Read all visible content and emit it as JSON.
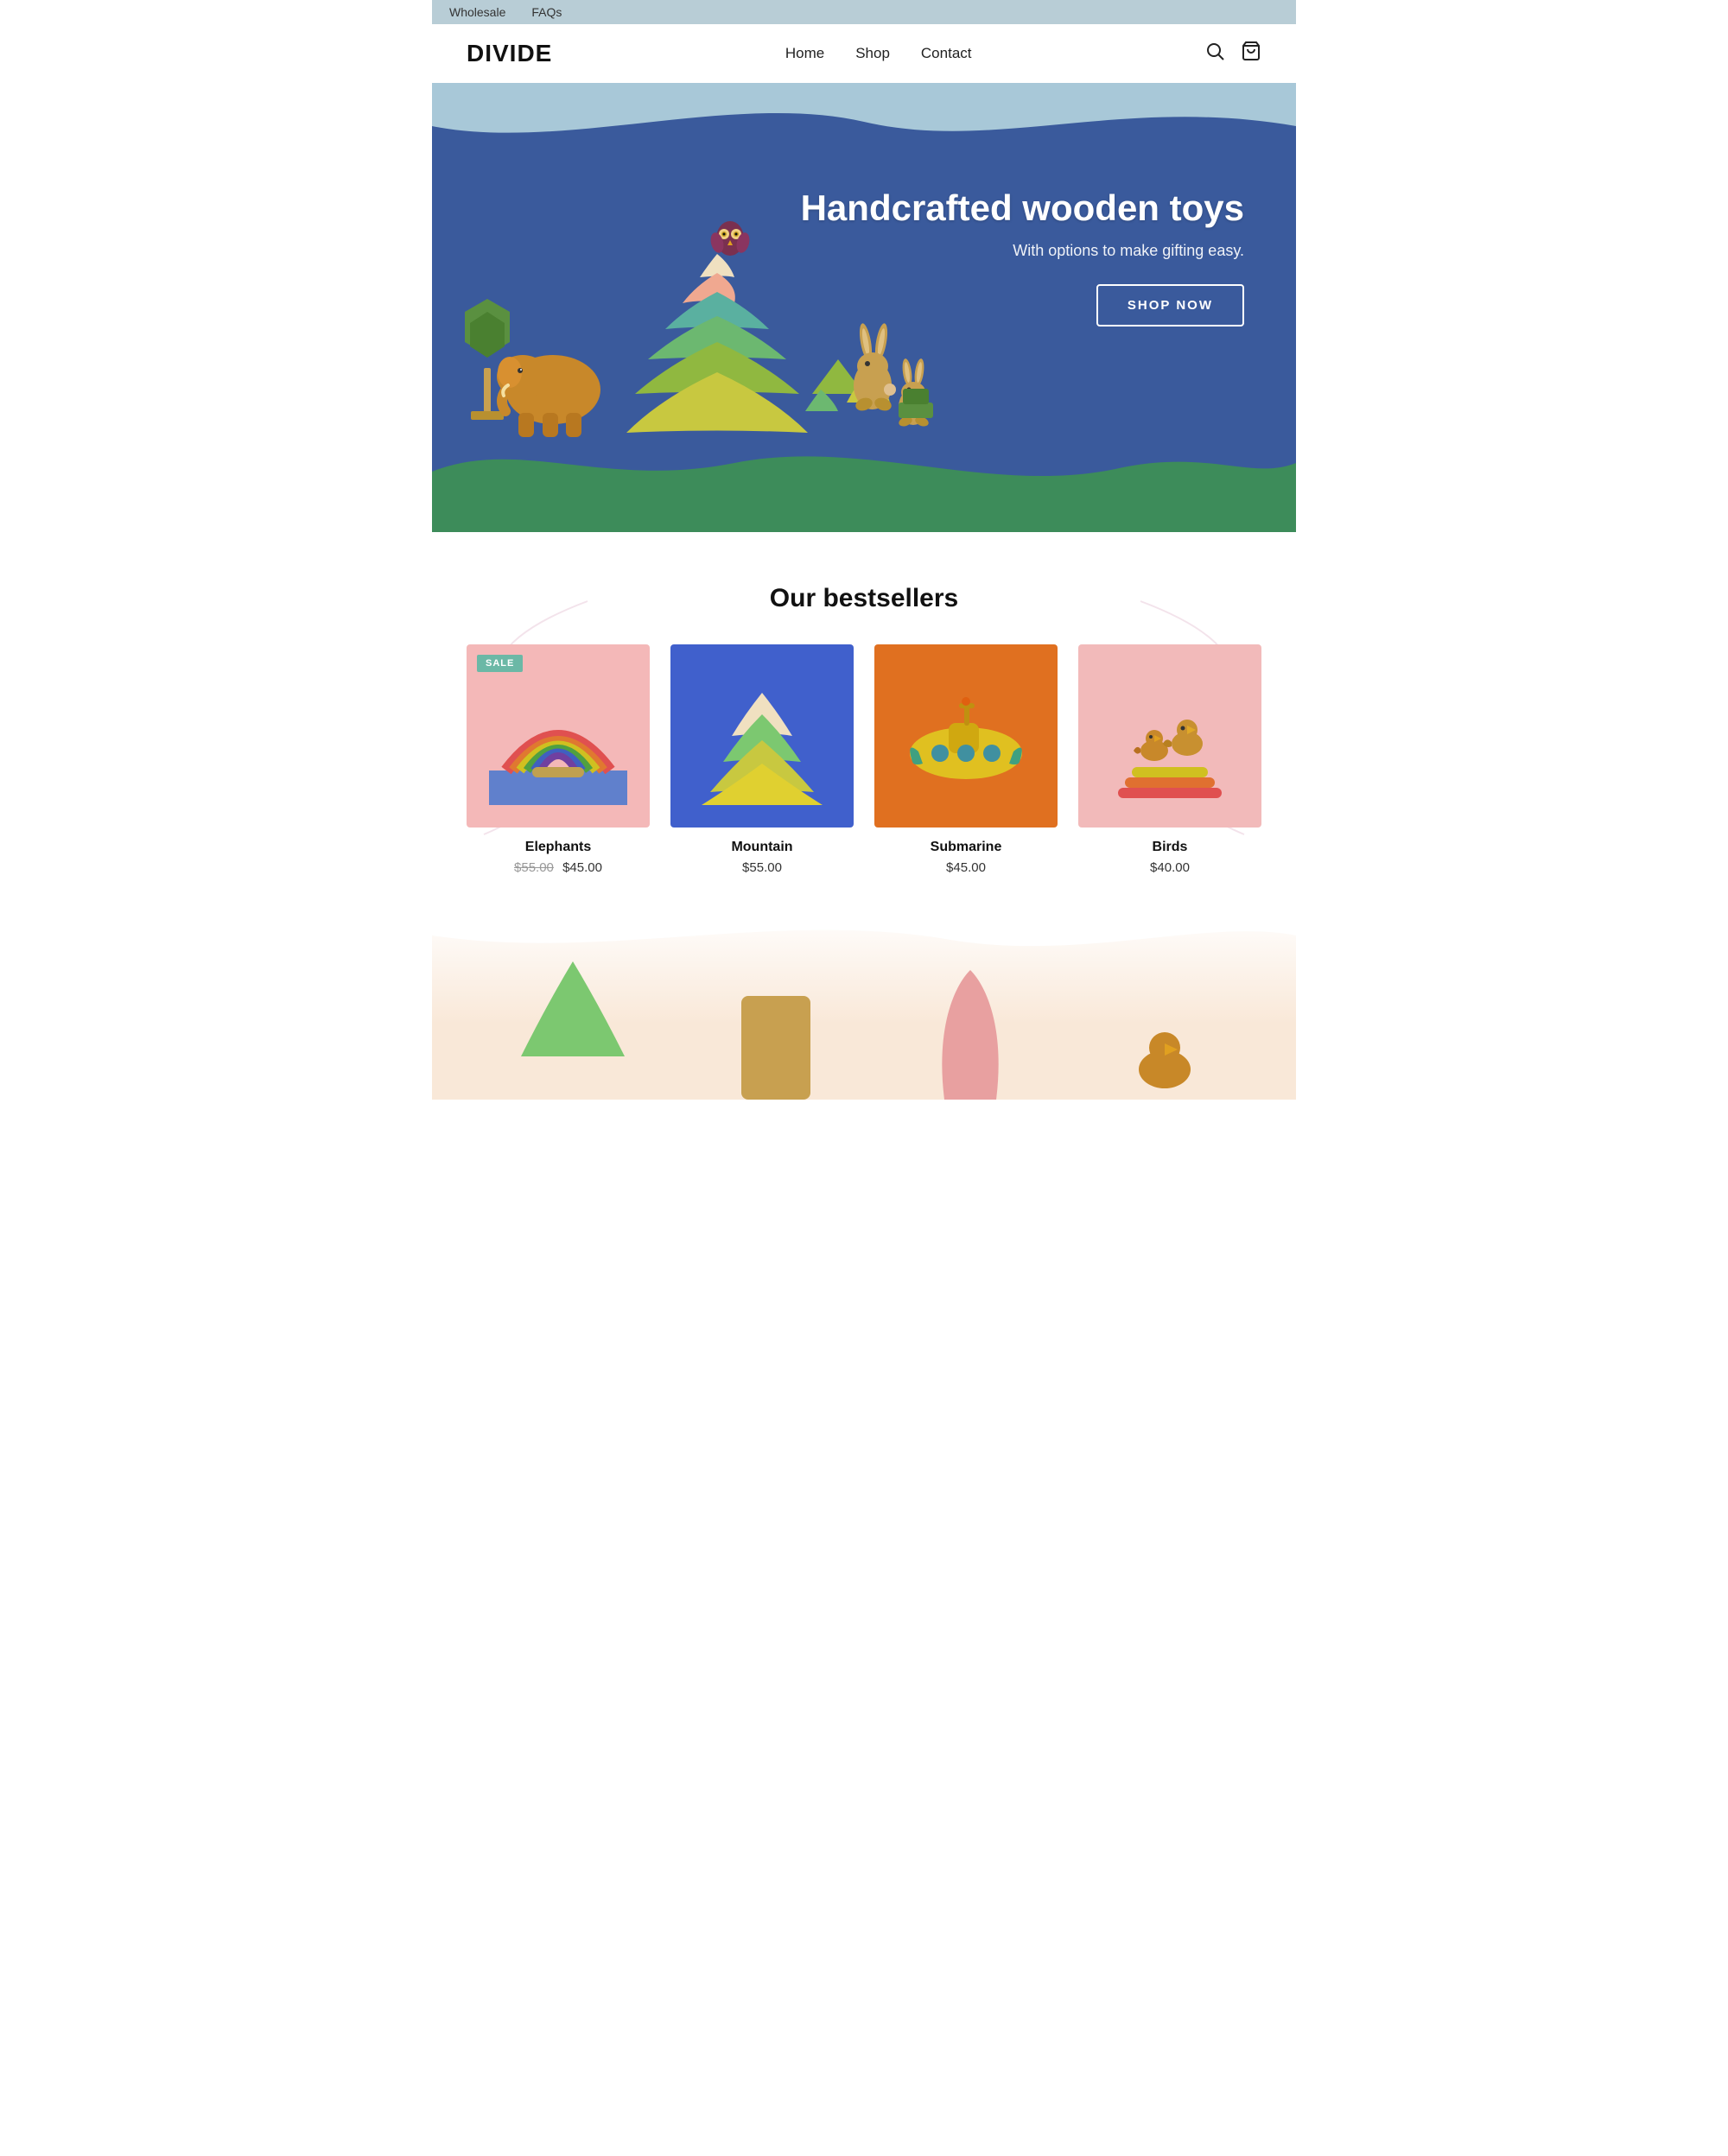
{
  "topbar": {
    "links": [
      "Wholesale",
      "FAQs"
    ]
  },
  "header": {
    "logo": "DIVIDE",
    "nav": [
      {
        "label": "Home",
        "href": "#"
      },
      {
        "label": "Shop",
        "href": "#"
      },
      {
        "label": "Contact",
        "href": "#"
      }
    ]
  },
  "hero": {
    "headline": "Handcrafted wooden toys",
    "subtext": "With options to make gifting easy.",
    "cta_label": "SHOP NOW"
  },
  "bestsellers": {
    "section_title": "Our bestsellers",
    "products": [
      {
        "name": "Elephants",
        "price_original": "$55.00",
        "price_sale": "$45.00",
        "has_sale": true,
        "bg_class": "bg-pink"
      },
      {
        "name": "Mountain",
        "price": "$55.00",
        "has_sale": false,
        "bg_class": "bg-blue"
      },
      {
        "name": "Submarine",
        "price": "$45.00",
        "has_sale": false,
        "bg_class": "bg-orange"
      },
      {
        "name": "Birds",
        "price": "$40.00",
        "has_sale": false,
        "bg_class": "bg-pink2"
      }
    ]
  },
  "labels": {
    "sale": "SALE"
  }
}
